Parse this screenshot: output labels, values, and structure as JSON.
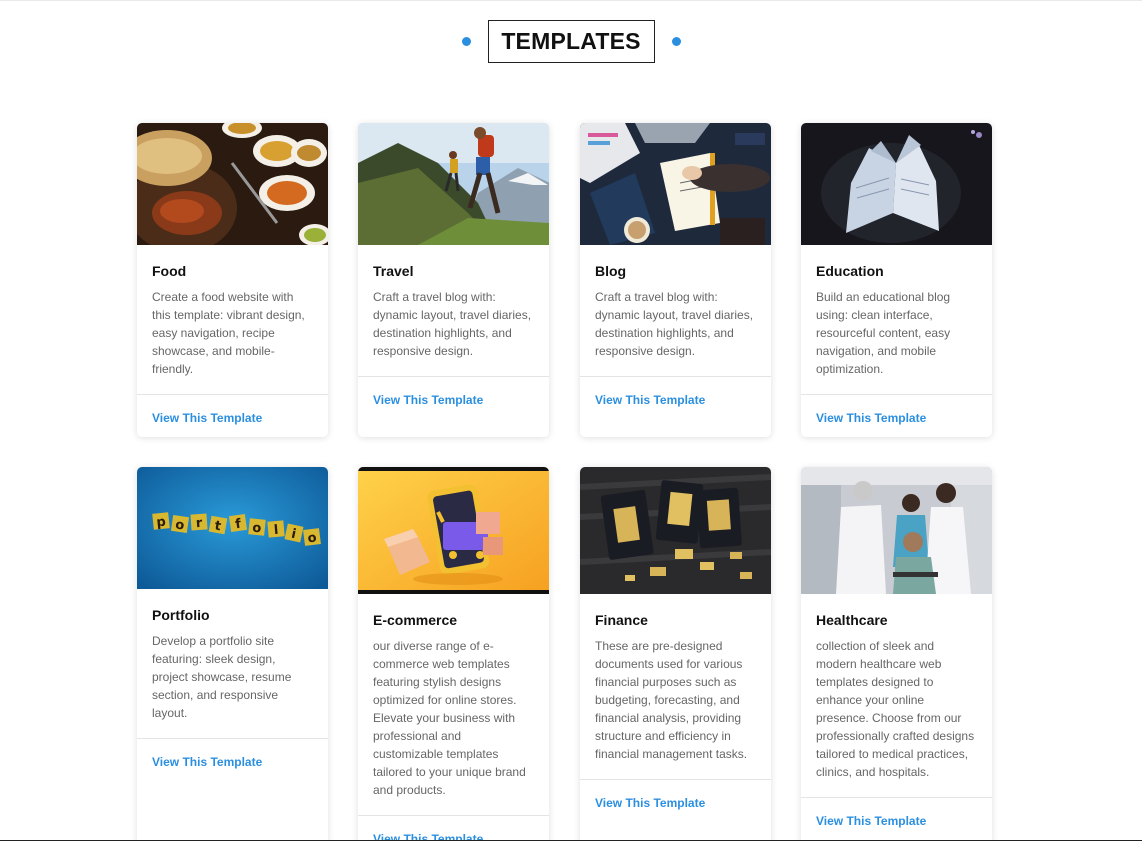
{
  "page": {
    "heading": "TEMPLATES"
  },
  "cards": [
    {
      "title": "Food",
      "description": "Create a food website with this template: vibrant design, easy navigation, recipe showcase, and mobile-friendly.",
      "link": "View This Template",
      "image": "food-photo"
    },
    {
      "title": "Travel",
      "description": "Craft a travel blog with: dynamic layout, travel diaries, destination highlights, and responsive design.",
      "link": "View This Template",
      "image": "hikers-photo"
    },
    {
      "title": "Blog",
      "description": "Craft a travel blog with: dynamic layout, travel diaries, destination highlights, and responsive design.",
      "link": "View This Template",
      "image": "desk-notebook-photo"
    },
    {
      "title": "Education",
      "description": "Build an educational blog using: clean interface, resourceful content, easy navigation, and mobile optimization.",
      "link": "View This Template",
      "image": "open-book-photo"
    },
    {
      "title": "Portfolio",
      "description": "Develop a portfolio site featuring: sleek design, project showcase, resume section, and responsive layout.",
      "link": "View This Template",
      "image": "portfolio-tiles-photo"
    },
    {
      "title": "E-commerce",
      "description": "our diverse range of e-commerce web templates featuring stylish designs optimized for online stores. Elevate your business with professional and customizable templates tailored to your unique brand and products.",
      "link": "View This Template",
      "image": "phone-cart-photo"
    },
    {
      "title": "Finance",
      "description": "These are pre-designed documents used for various financial purposes such as budgeting, forecasting, and financial analysis, providing structure and efficiency in financial management tasks.",
      "link": "View This Template",
      "image": "gold-bars-photo"
    },
    {
      "title": "Healthcare",
      "description": "collection of sleek and modern healthcare web templates designed to enhance your online presence. Choose from our professionally crafted designs tailored to medical practices, clinics, and hospitals.",
      "link": "View This Template",
      "image": "doctors-photo"
    }
  ],
  "colors": {
    "accent": "#2b8fe0",
    "title": "#111111",
    "text": "#666666"
  }
}
